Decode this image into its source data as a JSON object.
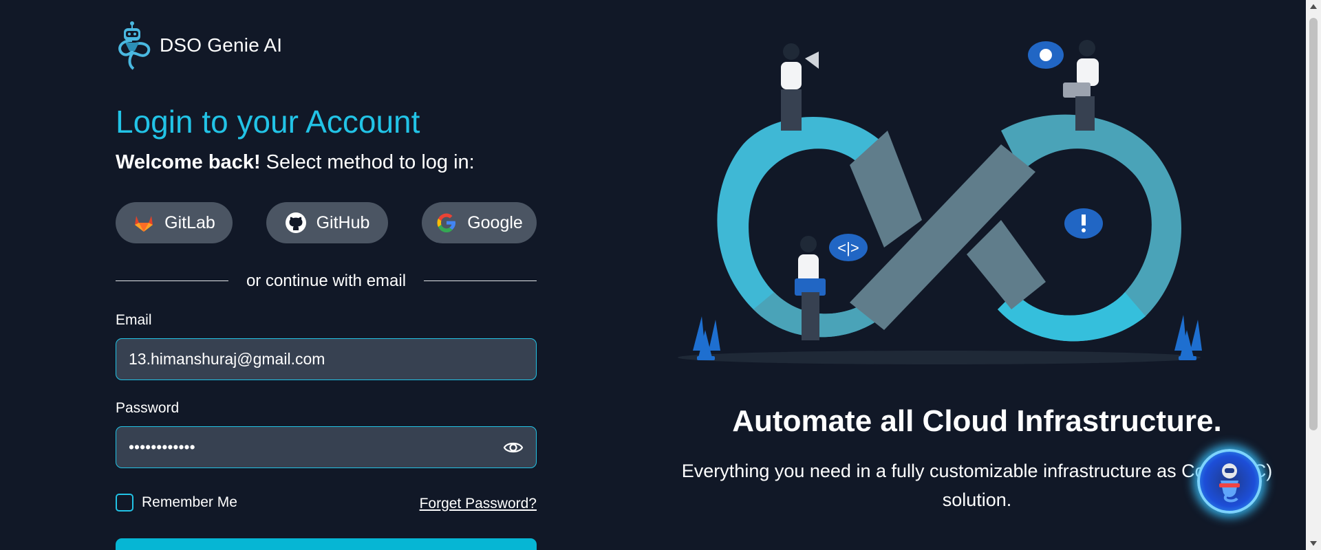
{
  "brand": {
    "name": "DSO Genie AI"
  },
  "login": {
    "title": "Login to your Account",
    "welcome_bold": "Welcome back!",
    "welcome_rest": " Select method to log in:",
    "oauth": [
      {
        "label": "GitLab",
        "icon": "gitlab-icon"
      },
      {
        "label": "GitHub",
        "icon": "github-icon"
      },
      {
        "label": "Google",
        "icon": "google-icon"
      }
    ],
    "divider_text": "or continue with email",
    "email_label": "Email",
    "email_value": "13.himanshuraj@gmail.com",
    "password_label": "Password",
    "password_value": "••••••••••••",
    "remember_label": "Remember Me",
    "remember_checked": false,
    "forgot_label": "Forget Password?"
  },
  "hero": {
    "tagline": "Automate all Cloud Infrastructure.",
    "description": "Everything you need in a fully customizable infrastructure as Code (IaC) solution."
  },
  "colors": {
    "background": "#111827",
    "accent": "#22c3e6",
    "button_bg": "#4b5563",
    "input_bg": "#374151"
  }
}
